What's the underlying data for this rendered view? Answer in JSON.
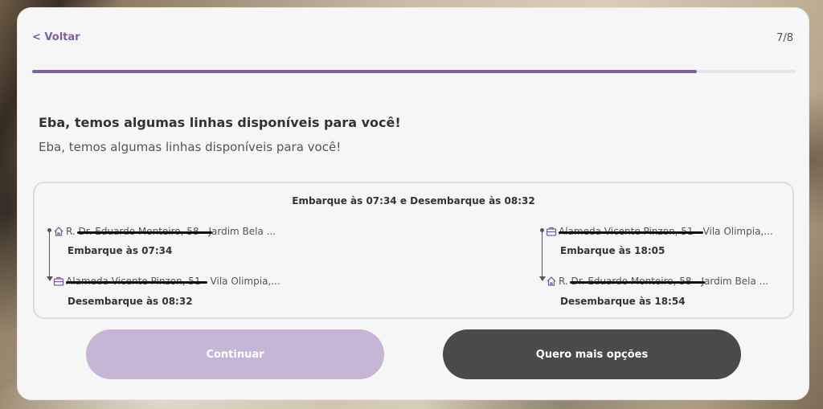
{
  "nav": {
    "back_label": "< Voltar",
    "step": "7/8",
    "progress": 0.87
  },
  "heading": {
    "title": "Eba, temos algumas linhas disponíveis para você!",
    "subtitle": "Eba, temos algumas linhas disponíveis para você!"
  },
  "trip": {
    "title": "Embarque às 07:34 e Desembarque às 08:32",
    "outbound": {
      "origin": {
        "address": "R. Dr. Eduardo Monteiro, 58 - Jardim Bela ...",
        "icon": "home-icon",
        "time_label": "Embarque às 07:34"
      },
      "destination": {
        "address": "Alameda Vicente Pinzon, 51 - Vila Olimpia,...",
        "icon": "briefcase-icon",
        "time_label": "Desembarque às 08:32"
      }
    },
    "return": {
      "origin": {
        "address": "Alameda Vicente Pinzon, 51 - Vila Olimpia,...",
        "icon": "briefcase-icon",
        "time_label": "Embarque às 18:05"
      },
      "destination": {
        "address": "R. Dr. Eduardo Monteiro, 58 - Jardim Bela ...",
        "icon": "home-icon",
        "time_label": "Desembarque às 18:54"
      }
    }
  },
  "actions": {
    "continue_label": "Continuar",
    "more_options_label": "Quero mais opções"
  },
  "colors": {
    "accent": "#7b5ea7",
    "continue_bg": "#c6b6d6",
    "more_bg": "#4a4a4c"
  }
}
